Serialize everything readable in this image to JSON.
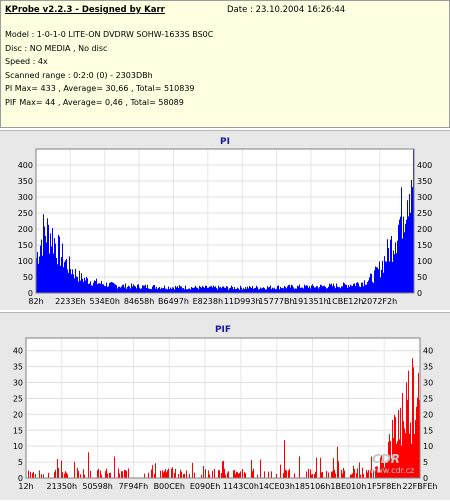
{
  "header": {
    "app_title": "KProbe v2.2.3 - Designed by Karr",
    "date": "Date : 23.10.2004 16:26:44",
    "lines": [
      "Model : 1-0-1-0 LITE-ON DVDRW SOHW-1633S BS0C",
      "Disc : NO MEDIA , No disc",
      "Speed : 4x",
      "Scanned range : 0:2:0 (0) - 2303DBh",
      "PI Max= 433 , Average= 30,66 , Total= 510839",
      "PIF Max= 44 , Average= 0,46 , Total= 58089"
    ]
  },
  "colors": {
    "pi_series": "#0000ff",
    "pif_series": "#ff0000",
    "plot_bg": "#ffffff",
    "panel_bg": "#e8e8e8"
  },
  "watermark": {
    "logo": "CDR",
    "site": "www.cdr.cz"
  },
  "chart_data": [
    {
      "type": "area",
      "title": "PI",
      "ylim": [
        0,
        450
      ],
      "y_ticks": [
        0,
        50,
        100,
        150,
        200,
        250,
        300,
        350,
        400
      ],
      "x_tick_labels": [
        "82h",
        "2233Eh",
        "534E0h",
        "84658h",
        "B6497h",
        "E8238h",
        "11D993h",
        "15777Bh",
        "191351h",
        "1CBE12h",
        "2072F2h",
        ""
      ],
      "grid": true,
      "series": [
        {
          "color": "#0000ff",
          "x_fraction": [
            0,
            0.02,
            0.04,
            0.06,
            0.08,
            0.1,
            0.12,
            0.15,
            0.18,
            0.22,
            0.28,
            0.35,
            0.45,
            0.55,
            0.65,
            0.75,
            0.82,
            0.86,
            0.89,
            0.91,
            0.93,
            0.95,
            0.97,
            0.985,
            1.0
          ],
          "values": [
            120,
            210,
            200,
            140,
            100,
            70,
            50,
            38,
            30,
            24,
            22,
            20,
            18,
            18,
            20,
            22,
            26,
            34,
            50,
            80,
            130,
            190,
            270,
            370,
            433
          ]
        }
      ]
    },
    {
      "type": "area",
      "title": "PIF",
      "ylim": [
        0,
        44
      ],
      "y_ticks": [
        0,
        5,
        10,
        15,
        20,
        25,
        30,
        35,
        40
      ],
      "x_tick_labels": [
        "12h",
        "21350h",
        "50598h",
        "7F94Fh",
        "B00CEh",
        "E090Eh",
        "1143C0h",
        "14CE03h",
        "185106h",
        "1BE010h",
        "1F5F8Eh",
        "22FBFEh"
      ],
      "grid": true,
      "series": [
        {
          "color": "#ff0000",
          "x_fraction": [
            0,
            0.05,
            0.1,
            0.2,
            0.3,
            0.4,
            0.5,
            0.55,
            0.6,
            0.65,
            0.7,
            0.75,
            0.8,
            0.85,
            0.88,
            0.9,
            0.92,
            0.94,
            0.96,
            0.98,
            1.0
          ],
          "values": [
            2,
            1,
            1,
            1,
            1,
            1,
            1,
            2,
            1,
            2,
            1,
            1,
            1,
            2,
            3,
            6,
            12,
            20,
            28,
            35,
            44
          ]
        }
      ]
    }
  ]
}
